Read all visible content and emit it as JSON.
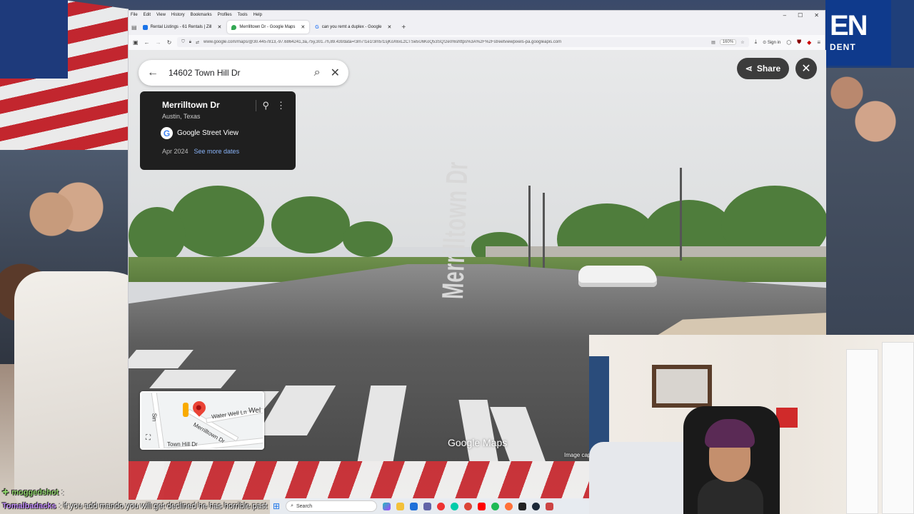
{
  "browser": {
    "menu": [
      "File",
      "Edit",
      "View",
      "History",
      "Bookmarks",
      "Profiles",
      "Tools",
      "Help"
    ],
    "tabs": [
      {
        "label": "Rental Listings - 61 Rentals | Zill",
        "color": "#1a73e8",
        "active": false
      },
      {
        "label": "Merrilltown Dr - Google Maps",
        "color": "#34a853",
        "active": true
      },
      {
        "label": "can you remt a duplex - Google",
        "color": "#ea4335",
        "active": false
      }
    ],
    "url": "www.google.com/maps/@30.4457813,-97.6864241,3a,75y,301.7h,89.43t/data=!3m7!1e1!3m5!1sjKoX6xLzCTSe5U6KoQ53SQ!2e0!6shttps%3A%2F%2Fstreetviewpixels-pa.googleapis.com",
    "zoom": "160%",
    "signin": "Sign in"
  },
  "maps": {
    "search_query": "14602 Town Hill Dr",
    "place_title": "Merrilltown Dr",
    "place_sub": "Austin, Texas",
    "provider": "Google Street View",
    "date": "Apr 2024",
    "more_dates": "See more dates",
    "share_label": "Share",
    "brand": "Google Maps",
    "image_caption": "Image cap",
    "road_marking": "Merrilltown Dr",
    "minimap_labels": {
      "water_well": "Water Well Ln",
      "merrilltown": "Merrilltown Dr",
      "town_hill": "Town Hill Dr",
      "welr": "Wel",
      "sin": "Sin"
    }
  },
  "stream": {
    "sign_text": "EN",
    "sign_sub": "DENT",
    "chat": [
      {
        "user": "moggedshot",
        "text": ":"
      },
      {
        "user": "Tomalbadacks",
        "text": ": if you add mando you will get declined he has horrible past"
      }
    ]
  },
  "taskbar": {
    "search_placeholder": "Search"
  }
}
